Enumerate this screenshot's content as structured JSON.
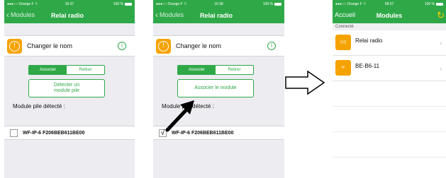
{
  "screens": [
    {
      "status": {
        "carrier": "●●●○○ Orange F ⌔",
        "time": "16:37",
        "battery": "100 %"
      },
      "nav": {
        "back": "Modules",
        "title": "Relai radio"
      },
      "rename_label": "Changer le nom",
      "segment": {
        "associate": "Associer",
        "remove": "Retirer"
      },
      "button_label": "Détecter un module pile",
      "detected_label": "Module pile détecté :",
      "module": {
        "checkbox": "",
        "text": "WF-IP-6   F206BEB611BE00"
      }
    },
    {
      "status": {
        "carrier": "●●●○○ Orange F ⌔",
        "time": "16:38",
        "battery": "100 %"
      },
      "nav": {
        "back": "Modules",
        "title": "Relai radio"
      },
      "rename_label": "Changer le nom",
      "segment": {
        "associate": "Associer",
        "remove": "Retirer"
      },
      "button_label": "Associer le module",
      "detected_label": "Module pile détecté :",
      "module": {
        "checkbox": "√",
        "text": "WF-IP-6   F206BEB611BE00"
      }
    },
    {
      "status": {
        "carrier": "●●●○○ Orange F ⌔",
        "time": "08:57",
        "battery": "100 %"
      },
      "nav": {
        "back": "Accueil",
        "title": "Modules"
      },
      "section": "Connecté",
      "items": [
        {
          "label": "Relai radio",
          "icon": "relay-radio-icon"
        },
        {
          "label": "BE-B6-11",
          "icon": "antenna-icon"
        }
      ]
    }
  ],
  "colors": {
    "accent": "#2fa948",
    "orange": "#f5a300"
  }
}
